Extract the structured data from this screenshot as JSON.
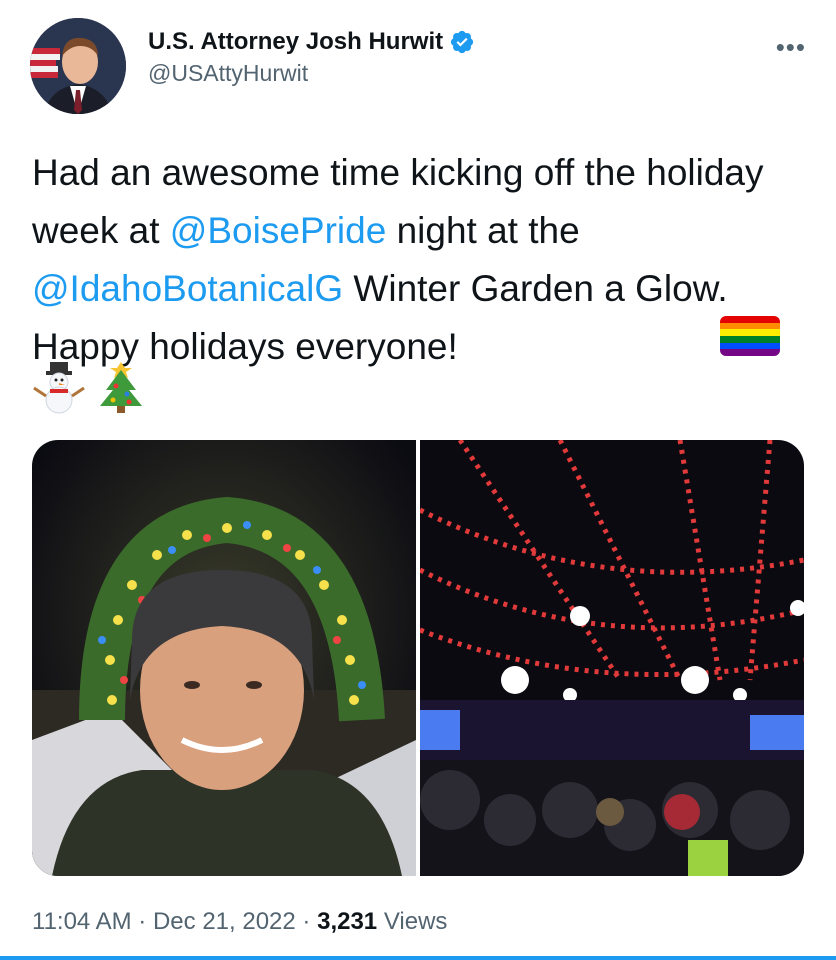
{
  "author": {
    "display_name": "U.S. Attorney Josh Hurwit",
    "handle": "@USAttyHurwit",
    "verified": true
  },
  "tweet": {
    "text_parts": [
      "Had an awesome time kicking off the holiday week at ",
      "@BoisePride",
      " night at the ",
      "@IdahoBotanicalG",
      " Winter Garden a Glow.  Happy holidays everyone!"
    ],
    "emojis": [
      "rainbow-flag",
      "snowman",
      "christmas-tree"
    ]
  },
  "media": {
    "photos": [
      {
        "description_icon": "selfie-wreath-photo"
      },
      {
        "description_icon": "crowd-lights-photo"
      }
    ]
  },
  "footer": {
    "time": "11:04 AM",
    "separator": "·",
    "date": "Dec 21, 2022",
    "views_count": "3,231",
    "views_label": "Views"
  },
  "colors": {
    "accent": "#1d9bf0",
    "text": "#0f1419",
    "muted": "#536471"
  }
}
